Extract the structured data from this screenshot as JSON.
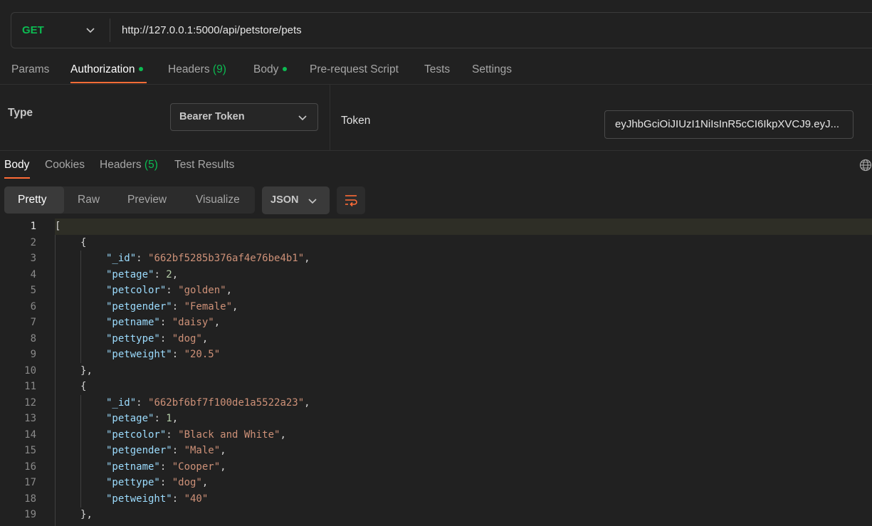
{
  "request": {
    "method": "GET",
    "url": "http://127.0.0.1:5000/api/petstore/pets",
    "tabs": [
      {
        "label": "Params",
        "dot": false,
        "count": ""
      },
      {
        "label": "Authorization",
        "dot": true,
        "count": ""
      },
      {
        "label": "Headers",
        "dot": false,
        "count": "(9)"
      },
      {
        "label": "Body",
        "dot": true,
        "count": ""
      },
      {
        "label": "Pre-request Script",
        "dot": false,
        "count": ""
      },
      {
        "label": "Tests",
        "dot": false,
        "count": ""
      },
      {
        "label": "Settings",
        "dot": false,
        "count": ""
      }
    ],
    "active_tab": "Authorization"
  },
  "auth": {
    "type_label": "Type",
    "type_value": "Bearer Token",
    "token_label": "Token",
    "token_value": "eyJhbGciOiJIUzI1NiIsInR5cCI6IkpXVCJ9.eyJ..."
  },
  "response": {
    "tabs": [
      {
        "label": "Body",
        "count": ""
      },
      {
        "label": "Cookies",
        "count": ""
      },
      {
        "label": "Headers",
        "count": "(5)"
      },
      {
        "label": "Test Results",
        "count": ""
      }
    ],
    "active_tab": "Body",
    "views": [
      "Pretty",
      "Raw",
      "Preview",
      "Visualize"
    ],
    "active_view": "Pretty",
    "format": "JSON"
  },
  "code_lines": [
    {
      "n": "1",
      "indent": 0,
      "key": "",
      "value": "",
      "vtype": "",
      "text": "[",
      "comma": false
    },
    {
      "n": "2",
      "indent": 1,
      "key": "",
      "value": "",
      "vtype": "",
      "text": "{",
      "comma": false
    },
    {
      "n": "3",
      "indent": 2,
      "key": "\"_id\"",
      "value": "\"662bf5285b376af4e76be4b1\"",
      "vtype": "s",
      "text": "",
      "comma": true
    },
    {
      "n": "4",
      "indent": 2,
      "key": "\"petage\"",
      "value": "2",
      "vtype": "n",
      "text": "",
      "comma": true
    },
    {
      "n": "5",
      "indent": 2,
      "key": "\"petcolor\"",
      "value": "\"golden\"",
      "vtype": "s",
      "text": "",
      "comma": true
    },
    {
      "n": "6",
      "indent": 2,
      "key": "\"petgender\"",
      "value": "\"Female\"",
      "vtype": "s",
      "text": "",
      "comma": true
    },
    {
      "n": "7",
      "indent": 2,
      "key": "\"petname\"",
      "value": "\"daisy\"",
      "vtype": "s",
      "text": "",
      "comma": true
    },
    {
      "n": "8",
      "indent": 2,
      "key": "\"pettype\"",
      "value": "\"dog\"",
      "vtype": "s",
      "text": "",
      "comma": true
    },
    {
      "n": "9",
      "indent": 2,
      "key": "\"petweight\"",
      "value": "\"20.5\"",
      "vtype": "s",
      "text": "",
      "comma": false
    },
    {
      "n": "10",
      "indent": 1,
      "key": "",
      "value": "",
      "vtype": "",
      "text": "}",
      "comma": true
    },
    {
      "n": "11",
      "indent": 1,
      "key": "",
      "value": "",
      "vtype": "",
      "text": "{",
      "comma": false
    },
    {
      "n": "12",
      "indent": 2,
      "key": "\"_id\"",
      "value": "\"662bf6bf7f100de1a5522a23\"",
      "vtype": "s",
      "text": "",
      "comma": true
    },
    {
      "n": "13",
      "indent": 2,
      "key": "\"petage\"",
      "value": "1",
      "vtype": "n",
      "text": "",
      "comma": true
    },
    {
      "n": "14",
      "indent": 2,
      "key": "\"petcolor\"",
      "value": "\"Black and White\"",
      "vtype": "s",
      "text": "",
      "comma": true
    },
    {
      "n": "15",
      "indent": 2,
      "key": "\"petgender\"",
      "value": "\"Male\"",
      "vtype": "s",
      "text": "",
      "comma": true
    },
    {
      "n": "16",
      "indent": 2,
      "key": "\"petname\"",
      "value": "\"Cooper\"",
      "vtype": "s",
      "text": "",
      "comma": true
    },
    {
      "n": "17",
      "indent": 2,
      "key": "\"pettype\"",
      "value": "\"dog\"",
      "vtype": "s",
      "text": "",
      "comma": true
    },
    {
      "n": "18",
      "indent": 2,
      "key": "\"petweight\"",
      "value": "\"40\"",
      "vtype": "s",
      "text": "",
      "comma": false
    },
    {
      "n": "19",
      "indent": 1,
      "key": "",
      "value": "",
      "vtype": "",
      "text": "}",
      "comma": true
    }
  ],
  "colors": {
    "accent": "#ff6c37",
    "method_get": "#0cbb52",
    "json_key": "#9cdcfe",
    "json_string": "#ce9178",
    "json_number": "#b5cea8"
  }
}
